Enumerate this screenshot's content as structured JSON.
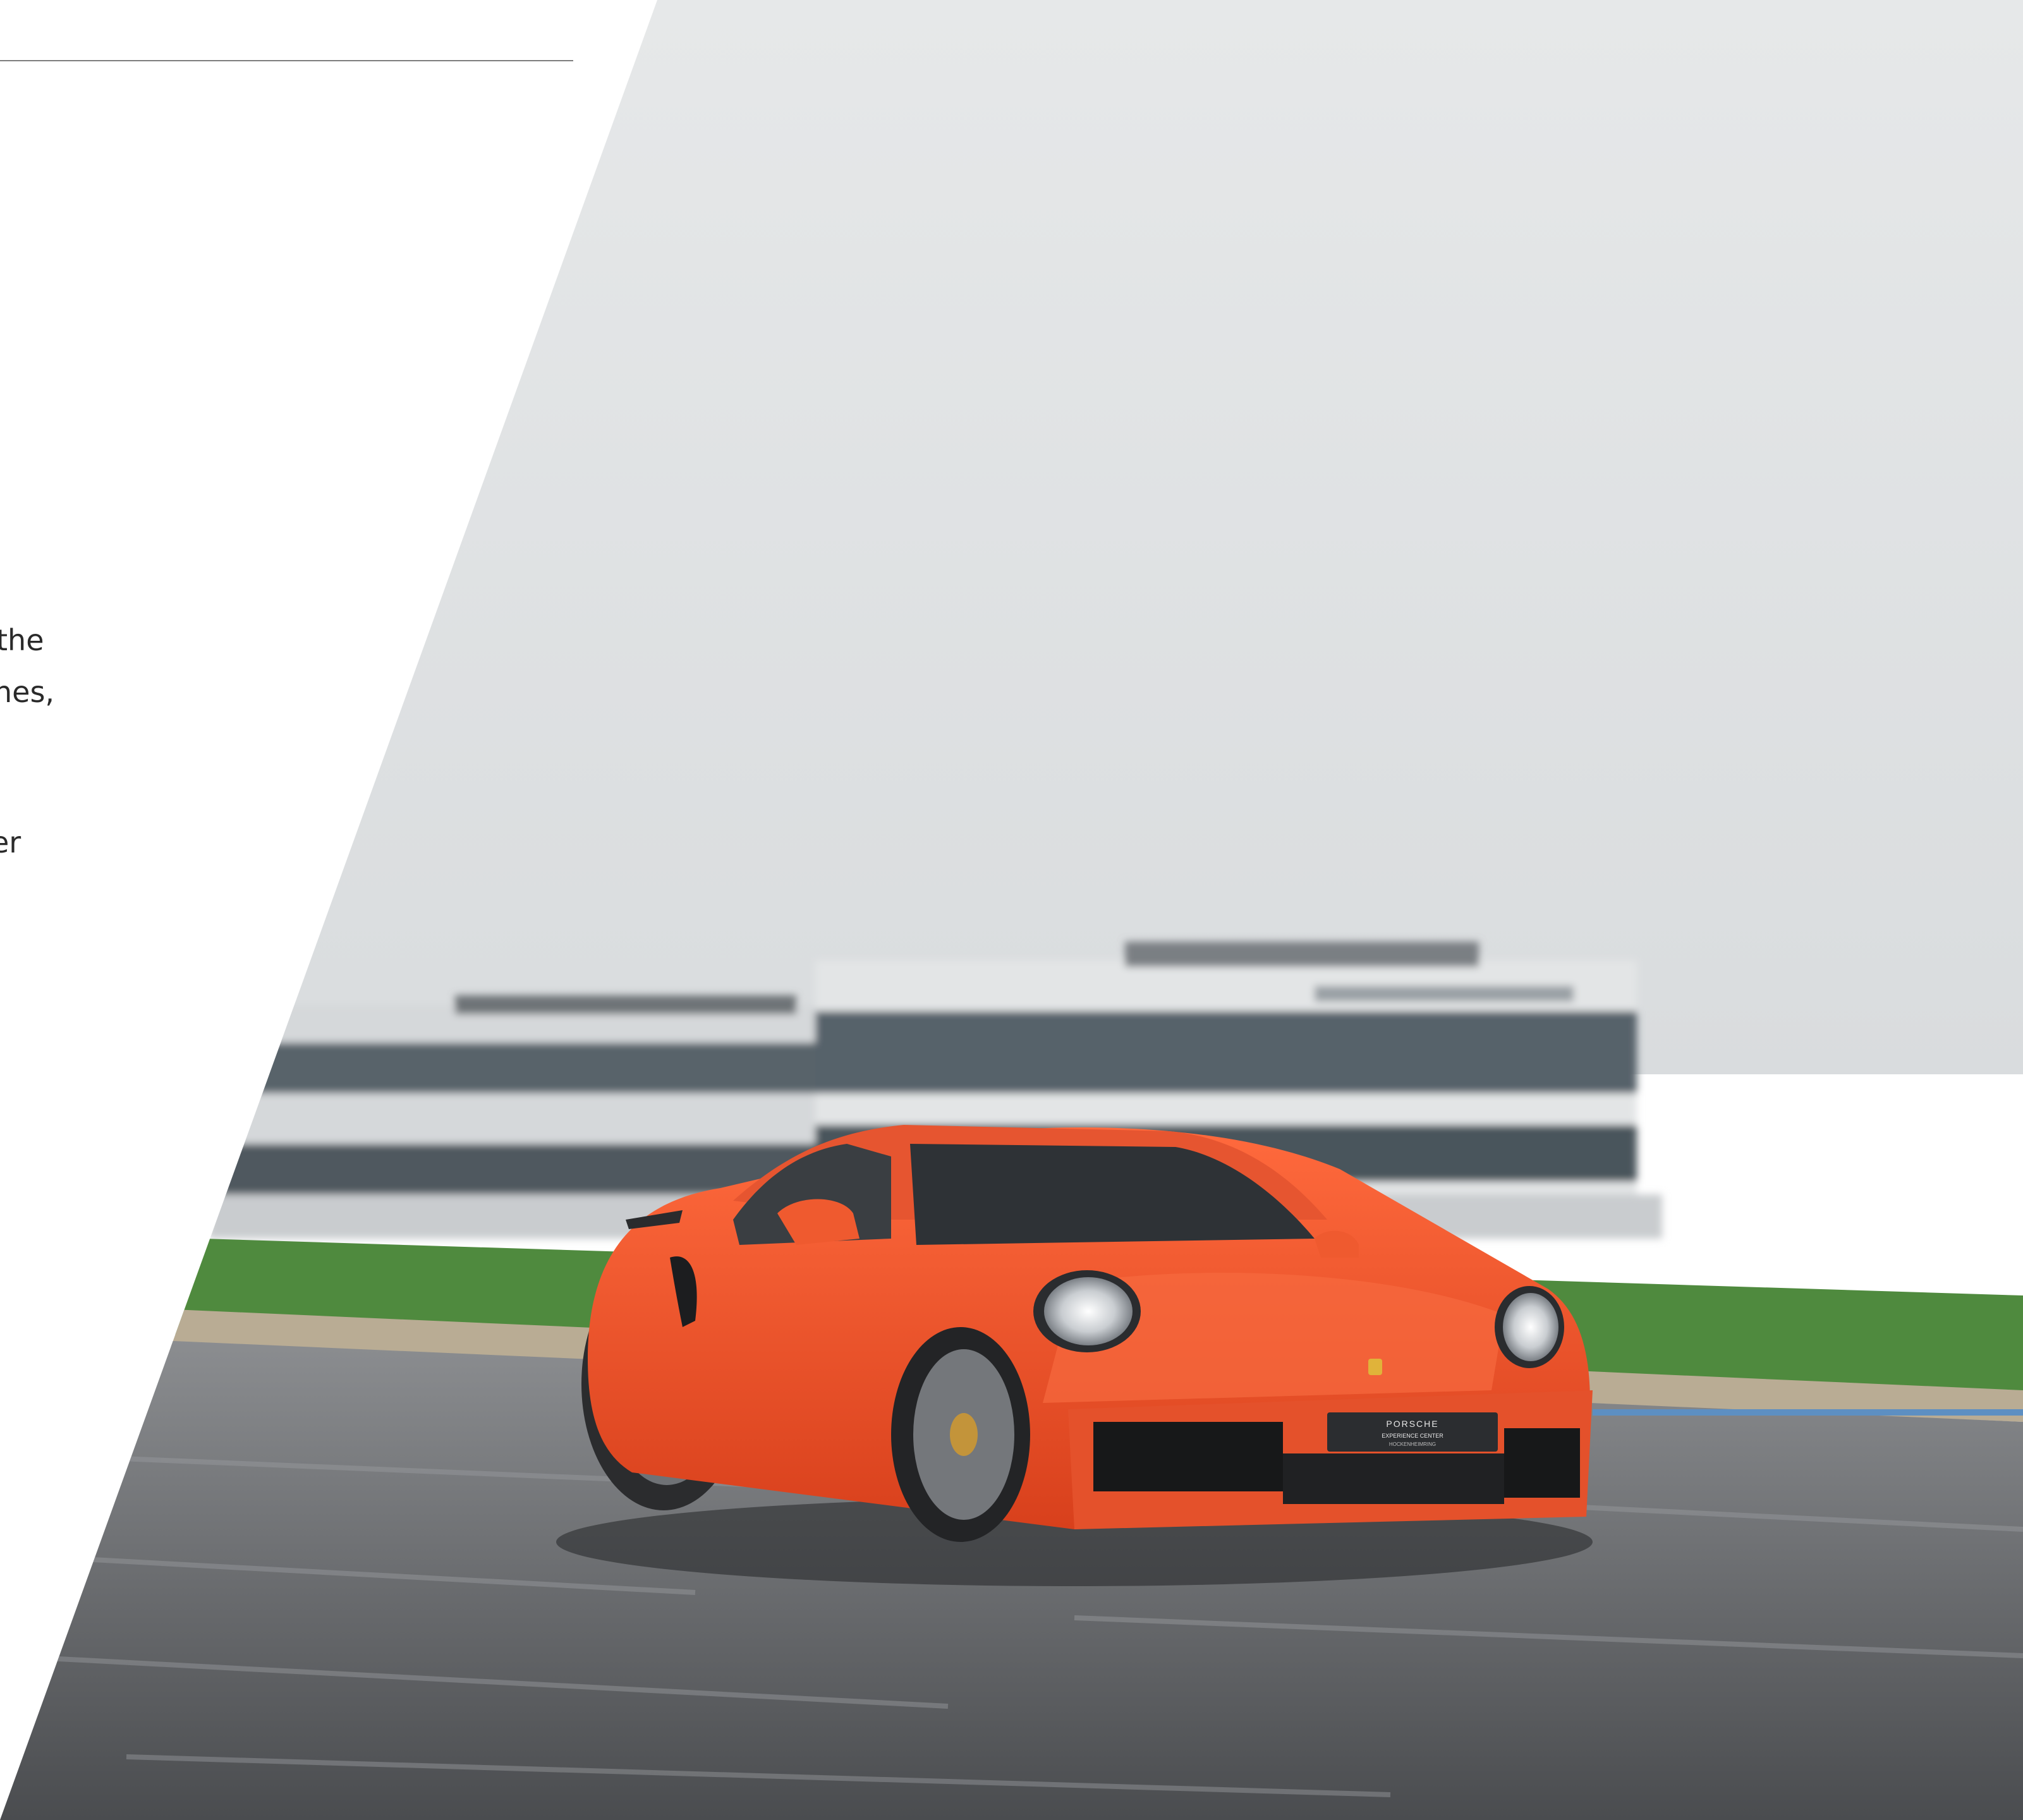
{
  "text_fragments": [
    {
      "text": "the"
    },
    {
      "text": "nes,"
    },
    {
      "text": "er"
    }
  ],
  "colors": {
    "car_body": "#f2572c",
    "sky": "#e2e4e5",
    "track": "#6f7174",
    "grass": "#4f8a3e",
    "divider": "#7d7d7d"
  },
  "plate": {
    "brand": "PORSCHE",
    "line1": "EXPERIENCE CENTER",
    "line2": "HOCKENHEIMRING"
  }
}
